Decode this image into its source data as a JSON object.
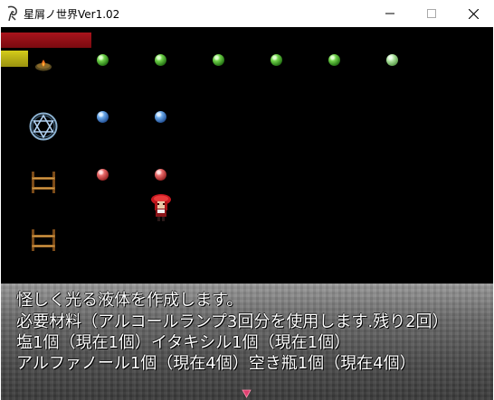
{
  "window": {
    "title": "星屑ノ世界Ver1.02",
    "controls": [
      "minimize",
      "maximize",
      "close"
    ]
  },
  "hud": {
    "hp_bar": {
      "color": "#a8141c",
      "fill": 1.0
    },
    "mp_bar": {
      "color": "#d4cc1a",
      "fill": 0.3
    }
  },
  "board": {
    "rows": [
      {
        "icon": "fire-ember-icon",
        "orbs": [
          "green",
          "green",
          "green",
          "green",
          "green",
          "green-pale"
        ]
      },
      {
        "icon": "hexagram-magic-circle-icon",
        "orbs": [
          "blue",
          "blue"
        ]
      },
      {
        "icon": "wooden-shelf-icon",
        "orbs": [
          "red",
          "red"
        ]
      },
      {
        "icon": "wooden-shelf-icon",
        "orbs": []
      }
    ],
    "character": "red-haired-girl-sprite"
  },
  "message": {
    "lines": [
      "怪しく光る液体を作成します。",
      "必要材料（アルコールランプ3回分を使用します.残り2回）",
      "塩1個（現在1個）イタキシル1個（現在1個）",
      "アルファノール1個（現在4個）空き瓶1個（現在4個）"
    ]
  },
  "colors": {
    "background": "#000000",
    "message_window": "#6a6a6a",
    "text": "#ffffff",
    "cursor": "#e04070"
  }
}
